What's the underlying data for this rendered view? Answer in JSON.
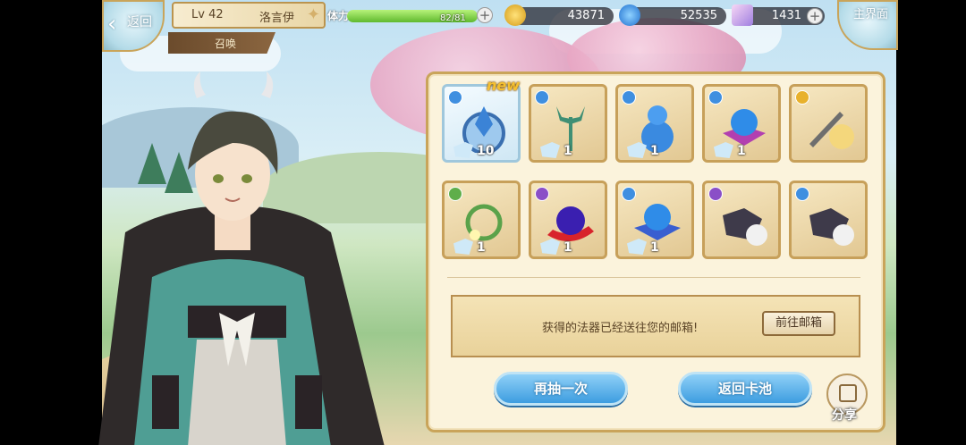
{
  "header": {
    "back_label": "返回",
    "home_label": "主界面",
    "player": {
      "level": "Lv 42",
      "name": "洛言伊"
    },
    "screen_title": "召唤",
    "stamina": {
      "label": "体力",
      "value": "82/81",
      "fill": 1.0
    },
    "currencies": [
      {
        "icon": "gold-coin-icon",
        "value": "43871"
      },
      {
        "icon": "blue-gem-icon",
        "value": "52535"
      },
      {
        "icon": "crystal-icon",
        "value": "1431"
      }
    ]
  },
  "results": {
    "new_badge": "new",
    "items": [
      {
        "name": "blue-ring-artifact",
        "element": "water",
        "qty": "10"
      },
      {
        "name": "trident-artifact",
        "element": "water",
        "qty": "1"
      },
      {
        "name": "blue-gourd-artifact",
        "element": "water",
        "qty": "1"
      },
      {
        "name": "purple-orb-artifact",
        "element": "water",
        "qty": "1"
      },
      {
        "name": "dagger-character-card",
        "element": "light",
        "qty": ""
      },
      {
        "name": "flower-wreath-artifact",
        "element": "wind",
        "qty": "1"
      },
      {
        "name": "red-scarf-orb-artifact",
        "element": "dark",
        "qty": "1"
      },
      {
        "name": "blue-orb-artifact",
        "element": "water",
        "qty": "1"
      },
      {
        "name": "dark-cloak-character-card",
        "element": "dark",
        "qty": ""
      },
      {
        "name": "dark-cloak-character-card-2",
        "element": "water",
        "qty": ""
      }
    ],
    "mail_message": "获得的法器已经送往您的邮箱!",
    "mail_button": "前往邮箱",
    "draw_again_button": "再抽一次",
    "return_pool_button": "返回卡池",
    "share_label": "分享"
  },
  "colors": {
    "water": "#3f8fe0",
    "light": "#e8b12c",
    "wind": "#5fae4a",
    "dark": "#8a4fc7"
  }
}
